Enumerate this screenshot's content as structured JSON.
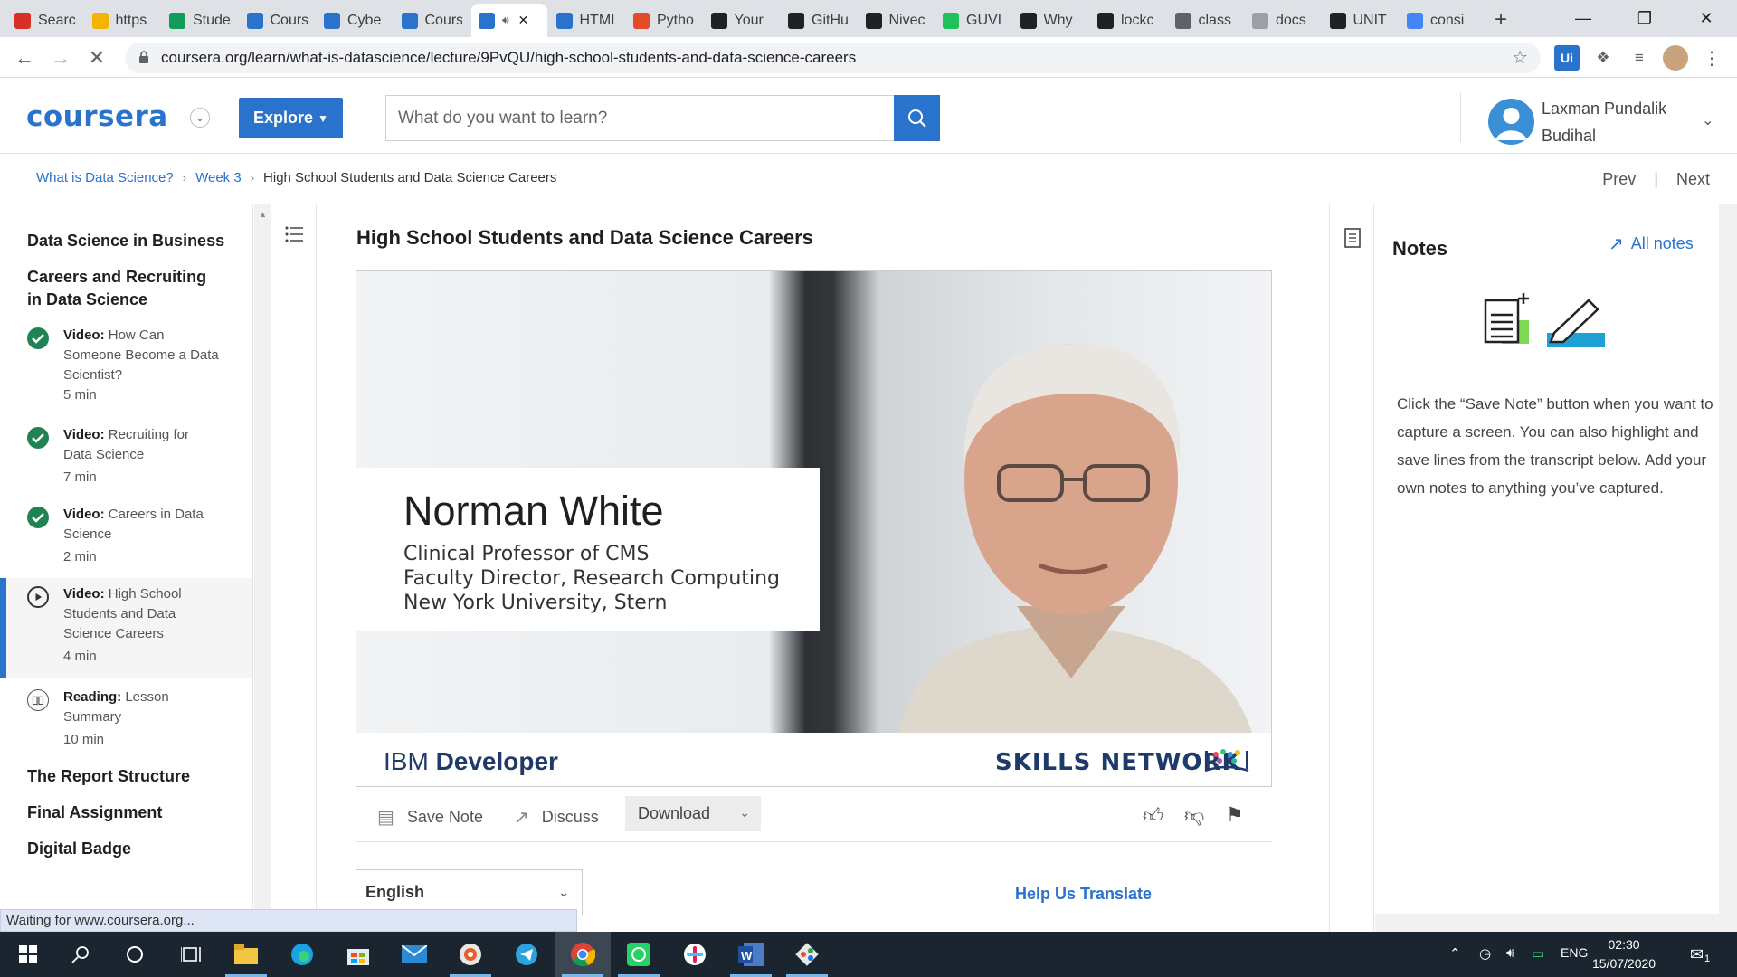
{
  "browser": {
    "tabs": [
      {
        "label": "Searc",
        "icon": "gmail-icon",
        "color": "#d93025"
      },
      {
        "label": "https",
        "icon": "folder-icon",
        "color": "#f4b400"
      },
      {
        "label": "Stude",
        "icon": "sheets-icon",
        "color": "#0f9d58"
      },
      {
        "label": "Cours",
        "icon": "coursera-icon",
        "color": "#2a73cc"
      },
      {
        "label": "Cybe",
        "icon": "coursera-icon",
        "color": "#2a73cc"
      },
      {
        "label": "Cours",
        "icon": "coursera-icon",
        "color": "#2a73cc"
      },
      {
        "label": "",
        "icon": "coursera-icon",
        "color": "#2a73cc",
        "active": true
      },
      {
        "label": "HTMI",
        "icon": "coursera-icon",
        "color": "#2a73cc"
      },
      {
        "label": "Pytho",
        "icon": "python-icon",
        "color": "#e34c26"
      },
      {
        "label": "Your",
        "icon": "github-icon",
        "color": "#202124"
      },
      {
        "label": "GitHu",
        "icon": "github-icon",
        "color": "#202124"
      },
      {
        "label": "Nivec",
        "icon": "github-icon",
        "color": "#202124"
      },
      {
        "label": "GUVI",
        "icon": "guvi-icon",
        "color": "#20c05c"
      },
      {
        "label": "Why",
        "icon": "github-icon",
        "color": "#202124"
      },
      {
        "label": "lockc",
        "icon": "github-icon",
        "color": "#202124"
      },
      {
        "label": "class",
        "icon": "classroom-icon",
        "color": "#5f6368"
      },
      {
        "label": "docs",
        "icon": "docs-icon",
        "color": "#9aa0a6"
      },
      {
        "label": "UNIT",
        "icon": "globe-icon",
        "color": "#202124"
      },
      {
        "label": "consi",
        "icon": "google-icon",
        "color": "#4285f4"
      }
    ],
    "url": "coursera.org/learn/what-is-datascience/lecture/9PvQU/high-school-students-and-data-science-careers",
    "status_text": "Waiting for www.coursera.org..."
  },
  "header": {
    "logo": "coursera",
    "explore_label": "Explore",
    "search_placeholder": "What do you want to learn?",
    "user_first": "Laxman Pundalik",
    "user_last": "Budihal"
  },
  "breadcrumb": {
    "course": "What is Data Science?",
    "week": "Week 3",
    "current": "High School Students and Data Science Careers",
    "prev": "Prev",
    "next": "Next"
  },
  "sidebar": {
    "mod1": "Data Science in Business",
    "mod2a": "Careers and Recruiting",
    "mod2b": "in Data Science",
    "items": [
      {
        "kind": "Video:",
        "l1": "How Can",
        "l2": "Someone Become a Data",
        "l3": "Scientist?",
        "min": "5 min"
      },
      {
        "kind": "Video:",
        "l1": "Recruiting for",
        "l2": "Data Science",
        "min": "7 min"
      },
      {
        "kind": "Video:",
        "l1": "Careers in Data",
        "l2": "Science",
        "min": "2 min"
      },
      {
        "kind": "Video:",
        "l1": "High School",
        "l2": "Students and Data",
        "l3": "Science Careers",
        "min": "4 min"
      },
      {
        "kind": "Reading:",
        "l1": "Lesson",
        "l2": "Summary",
        "min": "10 min"
      }
    ],
    "mod3": "The Report Structure",
    "mod4": "Final Assignment",
    "mod5": "Digital Badge"
  },
  "lesson": {
    "title": "High School Students and Data Science Careers",
    "video": {
      "name": "Norman White",
      "line1": "Clinical Professor of CMS",
      "line2": "Faculty Director, Research Computing",
      "line3": "New York University, Stern",
      "brand_left_a": "IBM ",
      "brand_left_b": "Developer",
      "brand_right": "SKILLS NETWORK"
    },
    "actions": {
      "save_note": "Save Note",
      "discuss": "Discuss",
      "download": "Download"
    },
    "language": "English",
    "help_translate": "Help Us Translate"
  },
  "notes": {
    "title": "Notes",
    "all_notes": "All notes",
    "text": "Click the “Save Note” button when you want to capture a screen. You can also highlight and save lines from the transcript below. Add your own notes to anything you’ve captured."
  },
  "taskbar": {
    "lang": "ENG",
    "time": "02:30",
    "date": "15/07/2020",
    "notif_count": "1"
  }
}
